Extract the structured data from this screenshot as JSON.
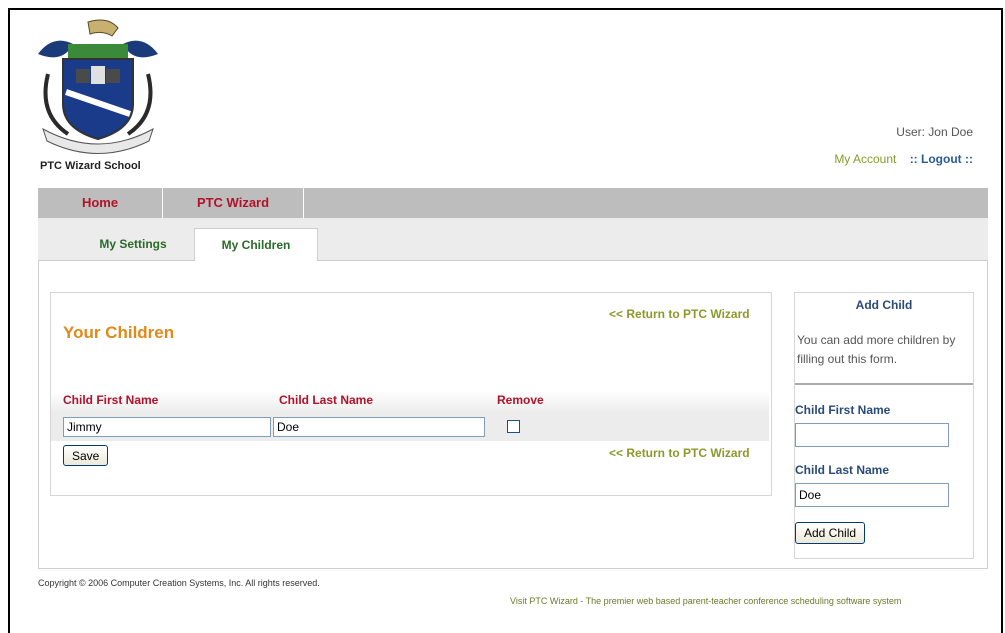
{
  "header": {
    "school_name": "PTC Wizard School",
    "user_label": "User: Jon Doe",
    "my_account": "My Account",
    "logout": ":: Logout ::"
  },
  "main_nav": [
    {
      "label": "Home"
    },
    {
      "label": "PTC Wizard"
    }
  ],
  "sub_tabs": [
    {
      "label": "My Settings",
      "active": false
    },
    {
      "label": "My Children",
      "active": true
    }
  ],
  "children_panel": {
    "title": "Your Children",
    "return_link": "<< Return to PTC Wizard",
    "columns": [
      "Child First Name",
      "Child Last Name",
      "Remove"
    ],
    "rows": [
      {
        "first_name": "Jimmy",
        "last_name": "Doe",
        "remove": false
      }
    ],
    "save_label": "Save"
  },
  "add_child": {
    "title": "Add Child",
    "description": "You can add more children by filling out this form.",
    "first_name_label": "Child First Name",
    "first_name_value": "",
    "last_name_label": "Child Last Name",
    "last_name_value": "Doe",
    "button_label": "Add Child"
  },
  "footer": {
    "copyright": "Copyright © 2006 Computer Creation Systems, Inc. All rights reserved.",
    "tagline": "Visit PTC Wizard - The premier web based parent-teacher conference scheduling software system"
  },
  "colors": {
    "nav_text": "#b0122a",
    "tab_text": "#2a6a2a",
    "title_orange": "#e08a1a",
    "link_olive": "#8a9a2a",
    "label_blue": "#2a4a7a"
  },
  "icons": {
    "logo": "school-crest-logo"
  }
}
